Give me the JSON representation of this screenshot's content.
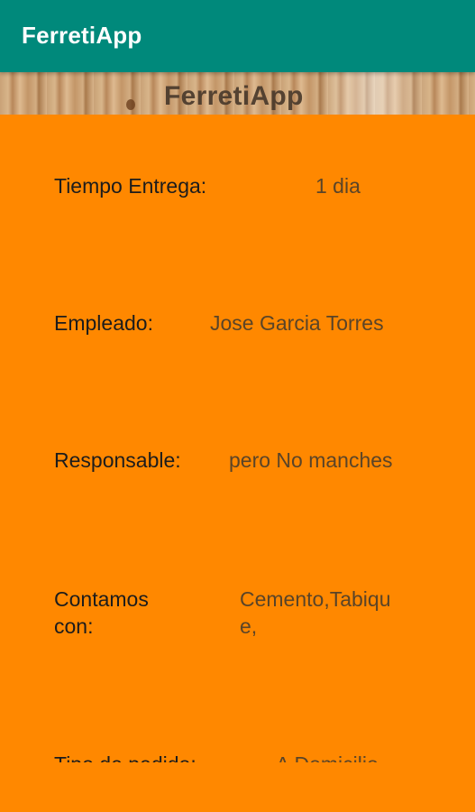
{
  "app_bar": {
    "title": "FerretiApp"
  },
  "banner": {
    "title": "FerretiApp"
  },
  "rows": [
    {
      "label": "Tiempo Entrega:",
      "value": "1 dia"
    },
    {
      "label": "Empleado:",
      "value": "Jose Garcia Torres"
    },
    {
      "label": "Responsable:",
      "value": "pero No manches"
    },
    {
      "label": "Contamos con:",
      "value": "Cemento,Tabique,"
    },
    {
      "label": "Tipo de pedido:",
      "value": "A Domicilio"
    }
  ],
  "colors": {
    "app_bar": "#00897b",
    "background": "#ff8800",
    "label_text": "#1c1c1c",
    "value_text": "#5a4428"
  }
}
